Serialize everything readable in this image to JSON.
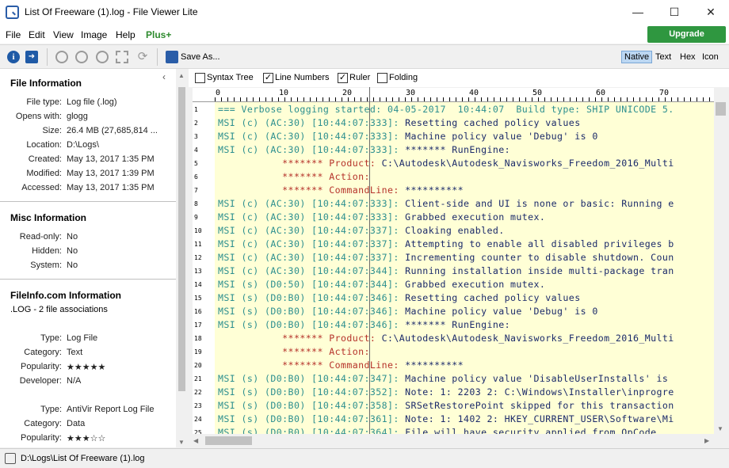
{
  "window": {
    "title": "List Of Freeware (1).log - File Viewer Lite",
    "minimize": "—",
    "maximize": "☐",
    "close": "✕"
  },
  "menu": [
    "File",
    "Edit",
    "View",
    "Image",
    "Help"
  ],
  "menu_plus": "Plus+",
  "upgrade_label": "Upgrade",
  "toolbar": {
    "icons": [
      "info-icon",
      "open-in-icon",
      "zoom-out-icon",
      "zoom-in-icon",
      "zoom-reset-icon",
      "fit-icon",
      "rotate-icon",
      "save-icon"
    ],
    "save_as": "Save As...",
    "views": [
      "Native",
      "Text",
      "Hex",
      "Icon"
    ],
    "active_view": "Native"
  },
  "sidebar": {
    "file_info_title": "File Information",
    "file_info": [
      {
        "label": "File type:",
        "value": "Log file (.log)"
      },
      {
        "label": "Opens with:",
        "value": "glogg"
      },
      {
        "label": "Size:",
        "value": "26.4 MB (27,685,814 ..."
      },
      {
        "label": "Location:",
        "value": "D:\\Logs\\"
      },
      {
        "label": "Created:",
        "value": "May 13, 2017 1:35 PM"
      },
      {
        "label": "Modified:",
        "value": "May 13, 2017 1:39 PM"
      },
      {
        "label": "Accessed:",
        "value": "May 13, 2017 1:35 PM"
      }
    ],
    "misc_title": "Misc Information",
    "misc": [
      {
        "label": "Read-only:",
        "value": "No"
      },
      {
        "label": "Hidden:",
        "value": "No"
      },
      {
        "label": "System:",
        "value": "No"
      }
    ],
    "fileinfo_title": "FileInfo.com Information",
    "fileinfo_sub": ".LOG - 2 file associations",
    "assoc1": [
      {
        "label": "Type:",
        "value": "Log File"
      },
      {
        "label": "Category:",
        "value": "Text"
      },
      {
        "label": "Popularity:",
        "value": "★★★★★"
      },
      {
        "label": "Developer:",
        "value": "N/A"
      }
    ],
    "assoc2": [
      {
        "label": "Type:",
        "value": "AntiVir Report Log File"
      },
      {
        "label": "Category:",
        "value": "Data"
      },
      {
        "label": "Popularity:",
        "value": "★★★☆☆"
      }
    ]
  },
  "options": [
    {
      "label": "Syntax Tree",
      "checked": false
    },
    {
      "label": "Line Numbers",
      "checked": true
    },
    {
      "label": "Ruler",
      "checked": true
    },
    {
      "label": "Folding",
      "checked": false
    }
  ],
  "ruler_numbers": [
    "0",
    "10",
    "20",
    "30",
    "40",
    "50",
    "60",
    "70"
  ],
  "lines": [
    [
      [
        "=== Verbose logging started: 04-05-2017  10:44:07  Build type: SHIP UNICODE 5.",
        "teal"
      ]
    ],
    [
      [
        "MSI (c) (AC:30) [10:44:07:333]: ",
        "teal"
      ],
      [
        "Resetting cached policy values",
        "navy"
      ]
    ],
    [
      [
        "MSI (c) (AC:30) [10:44:07:333]: ",
        "teal"
      ],
      [
        "Machine policy value 'Debug' is 0",
        "navy"
      ]
    ],
    [
      [
        "MSI (c) (AC:30) [10:44:07:333]: ",
        "teal"
      ],
      [
        "******* RunEngine:",
        "navy"
      ]
    ],
    [
      [
        "           ******* Product: ",
        "red"
      ],
      [
        "C:\\Autodesk\\Autodesk_Navisworks_Freedom_2016_Multi",
        "navy"
      ]
    ],
    [
      [
        "           ******* Action: ",
        "red"
      ]
    ],
    [
      [
        "           ******* CommandLine: ",
        "red"
      ],
      [
        "**********",
        "navy"
      ]
    ],
    [
      [
        "MSI (c) (AC:30) [10:44:07:333]: ",
        "teal"
      ],
      [
        "Client-side and UI is none or basic: Running e",
        "navy"
      ]
    ],
    [
      [
        "MSI (c) (AC:30) [10:44:07:333]: ",
        "teal"
      ],
      [
        "Grabbed execution mutex.",
        "navy"
      ]
    ],
    [
      [
        "MSI (c) (AC:30) [10:44:07:337]: ",
        "teal"
      ],
      [
        "Cloaking enabled.",
        "navy"
      ]
    ],
    [
      [
        "MSI (c) (AC:30) [10:44:07:337]: ",
        "teal"
      ],
      [
        "Attempting to enable all disabled privileges b",
        "navy"
      ]
    ],
    [
      [
        "MSI (c) (AC:30) [10:44:07:337]: ",
        "teal"
      ],
      [
        "Incrementing counter to disable shutdown. Coun",
        "navy"
      ]
    ],
    [
      [
        "MSI (c) (AC:30) [10:44:07:344]: ",
        "teal"
      ],
      [
        "Running installation inside multi-package tran",
        "navy"
      ]
    ],
    [
      [
        "MSI (s) (D0:50) [10:44:07:344]: ",
        "teal"
      ],
      [
        "Grabbed execution mutex.",
        "navy"
      ]
    ],
    [
      [
        "MSI (s) (D0:B0) [10:44:07:346]: ",
        "teal"
      ],
      [
        "Resetting cached policy values",
        "navy"
      ]
    ],
    [
      [
        "MSI (s) (D0:B0) [10:44:07:346]: ",
        "teal"
      ],
      [
        "Machine policy value 'Debug' is 0",
        "navy"
      ]
    ],
    [
      [
        "MSI (s) (D0:B0) [10:44:07:346]: ",
        "teal"
      ],
      [
        "******* RunEngine:",
        "navy"
      ]
    ],
    [
      [
        "           ******* Product: ",
        "red"
      ],
      [
        "C:\\Autodesk\\Autodesk_Navisworks_Freedom_2016_Multi",
        "navy"
      ]
    ],
    [
      [
        "           ******* Action: ",
        "red"
      ]
    ],
    [
      [
        "           ******* CommandLine: ",
        "red"
      ],
      [
        "**********",
        "navy"
      ]
    ],
    [
      [
        "MSI (s) (D0:B0) [10:44:07:347]: ",
        "teal"
      ],
      [
        "Machine policy value 'DisableUserInstalls' is",
        "navy"
      ]
    ],
    [
      [
        "MSI (s) (D0:B0) [10:44:07:352]: ",
        "teal"
      ],
      [
        "Note: 1: 2203 2: C:\\Windows\\Installer\\inprogre",
        "navy"
      ]
    ],
    [
      [
        "MSI (s) (D0:B0) [10:44:07:358]: ",
        "teal"
      ],
      [
        "SRSetRestorePoint skipped for this transaction",
        "navy"
      ]
    ],
    [
      [
        "MSI (s) (D0:B0) [10:44:07:361]: ",
        "teal"
      ],
      [
        "Note: 1: 1402 2: HKEY_CURRENT_USER\\Software\\Mi",
        "navy"
      ]
    ],
    [
      [
        "MSI (s) (D0:B0) [10:44:07:364]: ",
        "teal"
      ],
      [
        "File will have security applied from OpCode.",
        "navy"
      ]
    ]
  ],
  "status_path": "D:\\Logs\\List Of Freeware (1).log"
}
